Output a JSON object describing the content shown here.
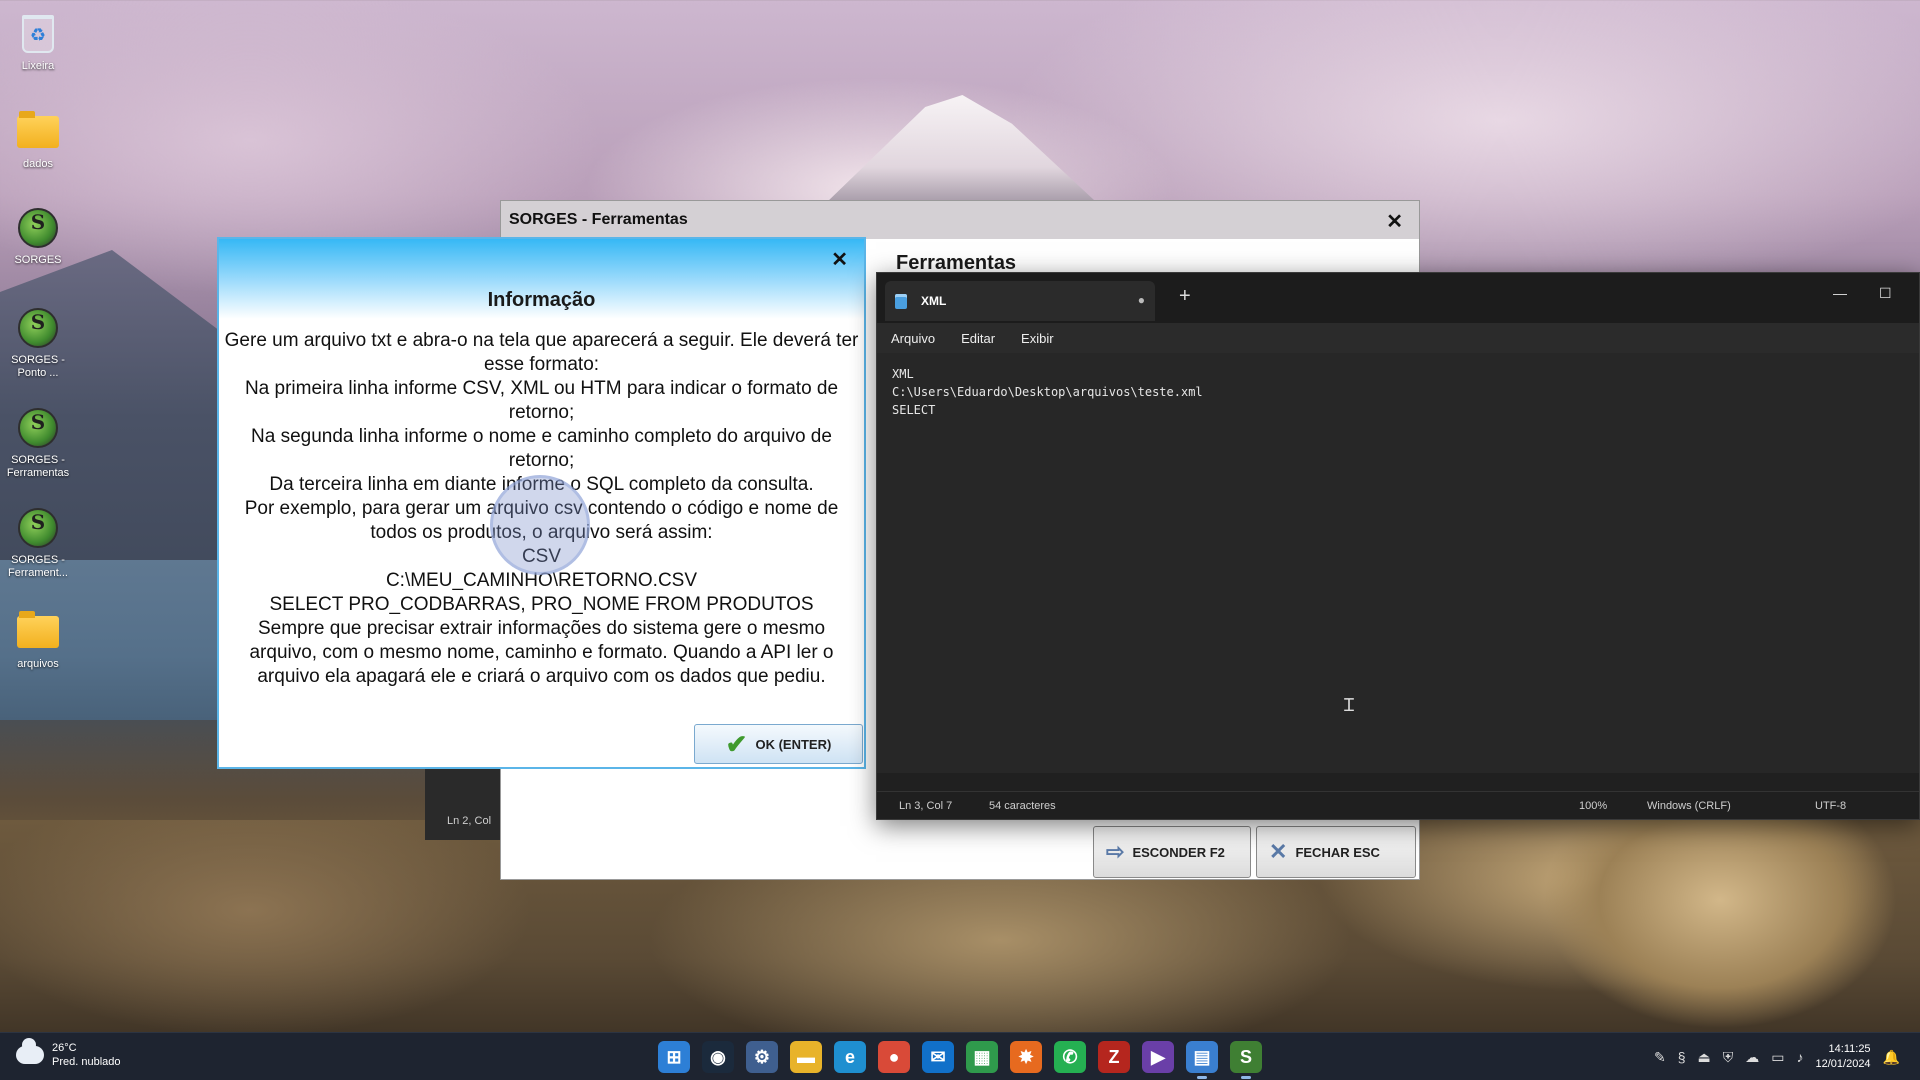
{
  "desktop": {
    "icons": [
      {
        "label": "Lixeira",
        "icon": "recycle-bin-icon"
      },
      {
        "label": "dados",
        "icon": "folder-icon"
      },
      {
        "label": "SORGES",
        "icon": "sorges-icon"
      },
      {
        "label": "SORGES - Ponto ...",
        "icon": "sorges-icon"
      },
      {
        "label": "SORGES - Ferramentas",
        "icon": "sorges-icon"
      },
      {
        "label": "SORGES - Ferrament...",
        "icon": "sorges-icon"
      },
      {
        "label": "arquivos",
        "icon": "folder-icon"
      }
    ]
  },
  "ferramentas_window": {
    "title": "SORGES - Ferramentas",
    "close_glyph": "✕",
    "heading": "Ferramentas",
    "esconder_label": "ESCONDER F2",
    "fechar_label": "FECHAR ESC",
    "status_partial": "Ln 2, Col"
  },
  "info_dialog": {
    "title": "Informação",
    "close_glyph": "✕",
    "lines": [
      "Gere um arquivo txt e abra-o na tela que aparecerá a seguir. Ele deverá ter esse formato:",
      "Na primeira linha informe CSV, XML ou HTM para indicar o formato de retorno;",
      "Na segunda linha informe o nome e caminho completo do arquivo de retorno;",
      "Da terceira linha em diante informe o SQL completo da consulta.",
      "Por exemplo, para gerar um arquivo csv contendo o código e nome de todos os produtos, o arquivo será assim:",
      "CSV",
      "C:\\MEU_CAMINHO\\RETORNO.CSV",
      "SELECT PRO_CODBARRAS, PRO_NOME FROM PRODUTOS",
      "Sempre que precisar extrair informações do sistema gere o mesmo arquivo, com o mesmo nome, caminho e formato. Quando a API ler o arquivo ela apagará ele e criará o arquivo com os dados que pediu."
    ],
    "ok_label": "OK (ENTER)"
  },
  "notepad": {
    "tab_name": "XML",
    "unsaved_dot": "●",
    "new_tab": "+",
    "menu": [
      "Arquivo",
      "Editar",
      "Exibir"
    ],
    "content_lines": [
      "XML",
      "C:\\Users\\Eduardo\\Desktop\\arquivos\\teste.xml",
      "SELECT"
    ],
    "status": {
      "position": "Ln 3, Col 7",
      "chars": "54 caracteres",
      "zoom": "100%",
      "line_ending": "Windows (CRLF)",
      "encoding": "UTF-8"
    }
  },
  "taskbar": {
    "weather_temp": "26°C",
    "weather_desc": "Pred. nublado",
    "apps": [
      "start-icon",
      "steam-icon",
      "settings-icon",
      "file-explorer-icon",
      "edge-icon",
      "chrome-icon",
      "outlook-icon",
      "spreadsheet-icon",
      "firefox-icon",
      "whatsapp-icon",
      "filezilla-icon",
      "video-editor-icon",
      "notepad-icon",
      "sorges-icon"
    ],
    "time": "14:11:25",
    "date": "12/01/2024"
  }
}
